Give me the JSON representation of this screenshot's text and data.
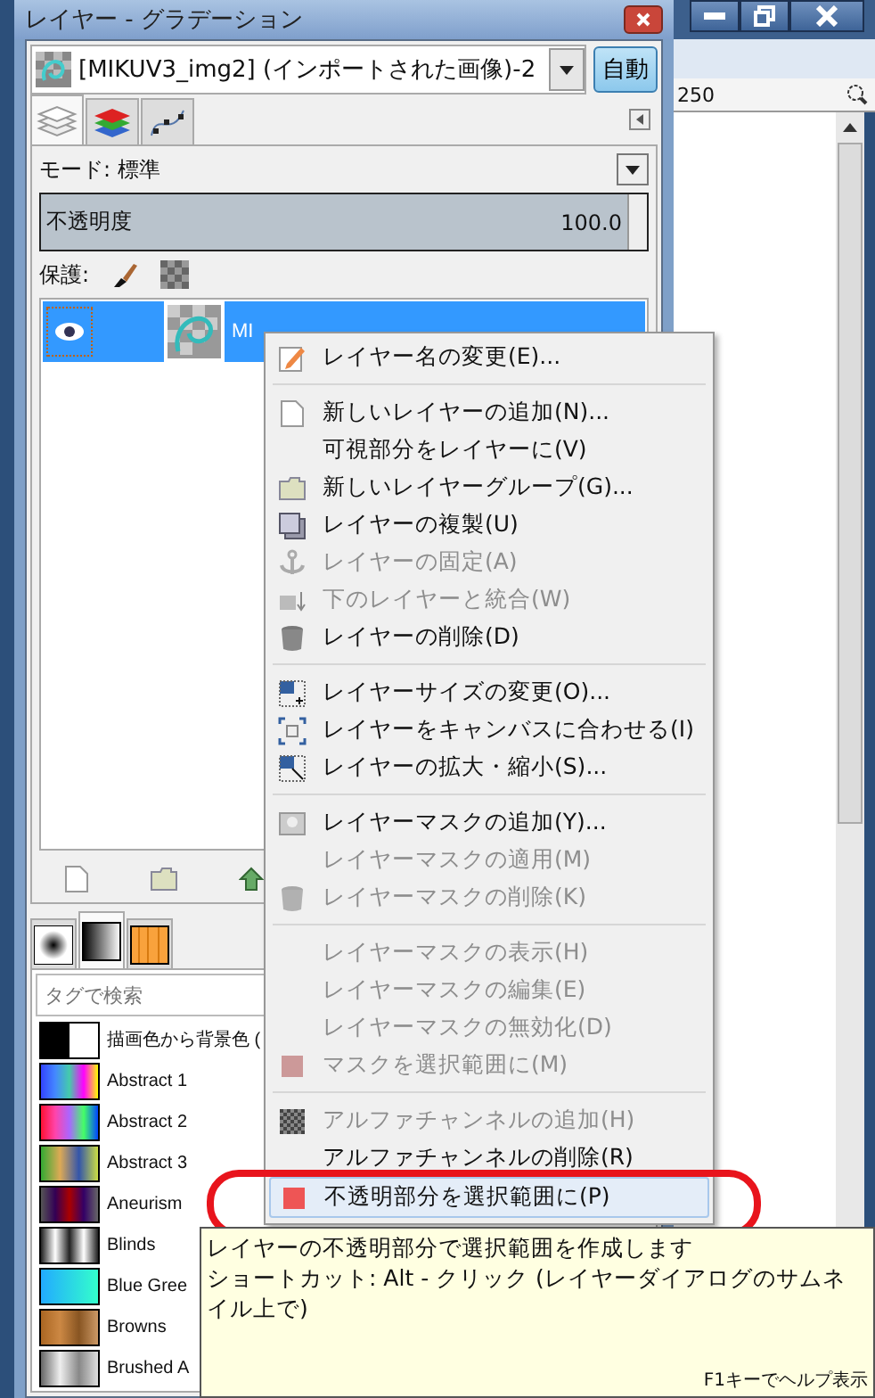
{
  "dialog": {
    "title": "レイヤー - グラデーション",
    "image_selector": "[MIKUV3_img2] (インポートされた画像)-2",
    "auto_button": "自動",
    "tabs": [
      {
        "selected": true
      },
      {
        "selected": false
      },
      {
        "selected": false
      }
    ],
    "mode_label": "モード: 標準",
    "opacity": {
      "label": "不透明度",
      "value": "100.0",
      "level": 1
    },
    "lock_label": "保護:",
    "layers": [
      {
        "name": "MI",
        "visible": true,
        "selected": true
      }
    ],
    "brush_tabs": [
      {
        "selected": false
      },
      {
        "selected": true
      },
      {
        "selected": false
      }
    ],
    "search": {
      "placeholder": "タグで検索"
    },
    "gradients": [
      {
        "name": "描画色から背景色 ("
      },
      {
        "name": "Abstract 1"
      },
      {
        "name": "Abstract 2"
      },
      {
        "name": "Abstract 3"
      },
      {
        "name": "Aneurism"
      },
      {
        "name": "Blinds"
      },
      {
        "name": "Blue Gree"
      },
      {
        "name": "Browns"
      },
      {
        "name": "Brushed A"
      }
    ]
  },
  "image_window": {
    "ruler_label": "250"
  },
  "context_menu": [
    {
      "kind": "item",
      "label": "レイヤー名の変更(E)...",
      "disabled": false,
      "selected": false
    },
    {
      "kind": "separator"
    },
    {
      "kind": "item",
      "label": "新しいレイヤーの追加(N)...",
      "disabled": false,
      "selected": false
    },
    {
      "kind": "item",
      "label": "可視部分をレイヤーに(V)",
      "disabled": false,
      "selected": false
    },
    {
      "kind": "item",
      "label": "新しいレイヤーグループ(G)...",
      "disabled": false,
      "selected": false
    },
    {
      "kind": "item",
      "label": "レイヤーの複製(U)",
      "disabled": false,
      "selected": false
    },
    {
      "kind": "item",
      "label": "レイヤーの固定(A)",
      "disabled": true,
      "selected": false
    },
    {
      "kind": "item",
      "label": "下のレイヤーと統合(W)",
      "disabled": true,
      "selected": false
    },
    {
      "kind": "item",
      "label": "レイヤーの削除(D)",
      "disabled": false,
      "selected": false
    },
    {
      "kind": "separator"
    },
    {
      "kind": "item",
      "label": "レイヤーサイズの変更(O)...",
      "disabled": false,
      "selected": false
    },
    {
      "kind": "item",
      "label": "レイヤーをキャンバスに合わせる(I)",
      "disabled": false,
      "selected": false
    },
    {
      "kind": "item",
      "label": "レイヤーの拡大・縮小(S)...",
      "disabled": false,
      "selected": false
    },
    {
      "kind": "separator"
    },
    {
      "kind": "item",
      "label": "レイヤーマスクの追加(Y)...",
      "disabled": false,
      "selected": false
    },
    {
      "kind": "item",
      "label": "レイヤーマスクの適用(M)",
      "disabled": true,
      "selected": false
    },
    {
      "kind": "item",
      "label": "レイヤーマスクの削除(K)",
      "disabled": true,
      "selected": false
    },
    {
      "kind": "separator"
    },
    {
      "kind": "item",
      "label": "レイヤーマスクの表示(H)",
      "disabled": true,
      "selected": false
    },
    {
      "kind": "item",
      "label": "レイヤーマスクの編集(E)",
      "disabled": true,
      "selected": false
    },
    {
      "kind": "item",
      "label": "レイヤーマスクの無効化(D)",
      "disabled": true,
      "selected": false
    },
    {
      "kind": "item",
      "label": "マスクを選択範囲に(M)",
      "disabled": true,
      "selected": false
    },
    {
      "kind": "separator"
    },
    {
      "kind": "item",
      "label": "アルファチャンネルの追加(H)",
      "disabled": true,
      "selected": false
    },
    {
      "kind": "item",
      "label": "アルファチャンネルの削除(R)",
      "disabled": false,
      "selected": false
    },
    {
      "kind": "item",
      "label": "不透明部分を選択範囲に(P)",
      "disabled": false,
      "selected": true
    }
  ],
  "tooltip": {
    "description": "レイヤーの不透明部分で選択範囲を作成します",
    "shortcut": "ショートカット: Alt - クリック (レイヤーダイアログのサムネイル上で)",
    "help": "F1キーでヘルプ表示"
  }
}
